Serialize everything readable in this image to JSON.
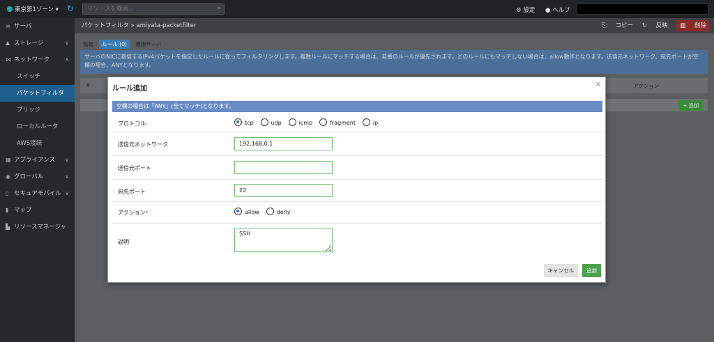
{
  "topbar": {
    "zone": "東京第1ゾーン ▾",
    "search_placeholder": "リソースを検索...",
    "settings": "⚙ 設定",
    "help": "● ヘルプ"
  },
  "sidebar": {
    "items": [
      {
        "icon": "≡",
        "label": "サーバ",
        "chev": ""
      },
      {
        "icon": "▲",
        "label": "ストレージ",
        "chev": "∨"
      },
      {
        "icon": "⋈",
        "label": "ネットワーク",
        "chev": "∧"
      },
      {
        "icon": "",
        "label": "スイッチ",
        "chev": ""
      },
      {
        "icon": "",
        "label": "パケットフィルタ",
        "chev": ""
      },
      {
        "icon": "",
        "label": "ブリッジ",
        "chev": ""
      },
      {
        "icon": "",
        "label": "ローカルルータ",
        "chev": ""
      },
      {
        "icon": "",
        "label": "AWS接続",
        "chev": ""
      },
      {
        "icon": "▦",
        "label": "アプライアンス",
        "chev": "∨"
      },
      {
        "icon": "◉",
        "label": "グローバル",
        "chev": "∨"
      },
      {
        "icon": "▯",
        "label": "セキュアモバイル",
        "chev": "∨"
      },
      {
        "icon": "▮",
        "label": "マップ",
        "chev": ""
      },
      {
        "icon": "▙",
        "label": "リソースマネージャ",
        "chev": ""
      }
    ]
  },
  "main": {
    "breadcrumb": "パケットフィルタ » amiyata-packetfilter",
    "copy": "コピー",
    "apply": "反映",
    "delete": "削除",
    "tabs": [
      "情報",
      "ルール (0)",
      "適用サーバ"
    ],
    "info": "サーバのNICに着信するIPv4パケットを指定したルールに従ってフィルタリングします。複数ルールにマッチする場合は、若番のルールが優先されます。どのルールにもマッチしない場合は、allow動作となります。送信元ネットワーク、宛先ポートが空欄の場合、ANYとなります。",
    "col_hash": "#",
    "col_action": "アクション",
    "add": "+ 追加"
  },
  "modal": {
    "title": "ルール追加",
    "close": "×",
    "notice": "空欄の場合は「ANY」(全てマッチ)となります。",
    "protocol_label": "プロトコル",
    "protocols": [
      "tcp",
      "udp",
      "icmp",
      "fragment",
      "ip"
    ],
    "protocol_selected": "tcp",
    "src_network_label": "送信元ネットワーク",
    "src_network": "192.168.0.1",
    "src_port_label": "送信元ポート",
    "src_port": "",
    "dst_port_label": "宛先ポート",
    "dst_port": "22",
    "action_label": "アクション",
    "required_mark": "*",
    "actions": [
      "allow",
      "deny"
    ],
    "action_selected": "allow",
    "desc_label": "説明",
    "desc": "SSH",
    "cancel": "キャンセル",
    "submit": "追加"
  }
}
